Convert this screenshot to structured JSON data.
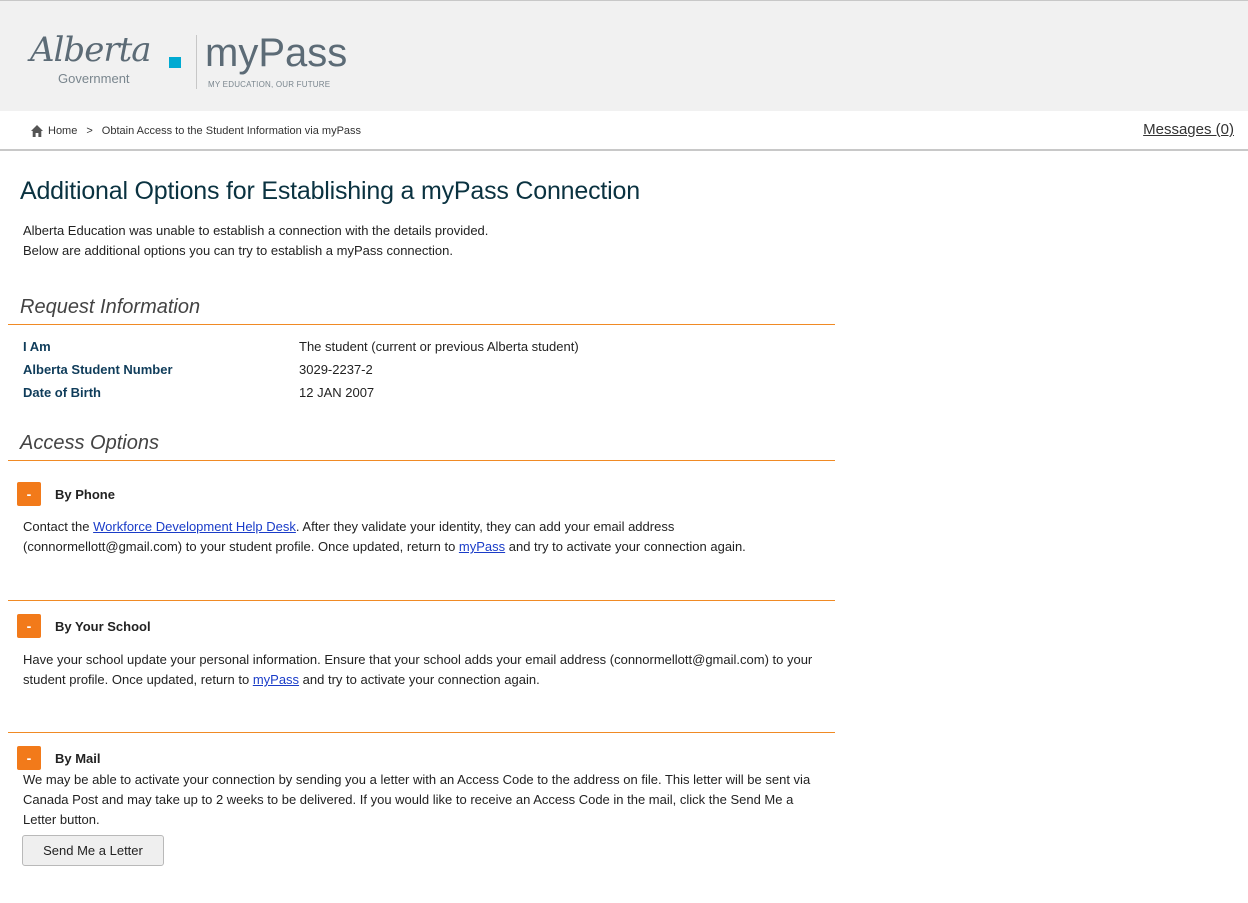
{
  "header": {
    "alberta_logo": "Alberta",
    "government_text": "Government",
    "mypass_title": "myPass",
    "mypass_tagline": "MY EDUCATION, OUR FUTURE"
  },
  "breadcrumb": {
    "home": "Home",
    "separator": ">",
    "current": "Obtain Access to the Student Information via myPass"
  },
  "messages_link": "Messages (0)",
  "page": {
    "title": "Additional Options for Establishing a myPass Connection",
    "intro_line1": "Alberta Education was unable to establish a connection with the details provided.",
    "intro_line2": "Below are additional options you can try to establish a myPass connection."
  },
  "request_info": {
    "heading": "Request Information",
    "rows": [
      {
        "label": "I Am",
        "value": "The student (current or previous Alberta student)"
      },
      {
        "label": "Alberta Student Number",
        "value": "3029-2237-2"
      },
      {
        "label": "Date of Birth",
        "value": "12 JAN 2007"
      }
    ]
  },
  "access_options": {
    "heading": "Access Options",
    "toggle_symbol": "-",
    "phone": {
      "title": "By Phone",
      "text_before": "Contact the ",
      "helpdesk_link": "Workforce Development Help Desk",
      "text_middle": ". After they validate your identity, they can add your email address (connormellott@gmail.com) to your student profile. Once updated, return to ",
      "mypass_link": "myPass",
      "text_after": " and try to activate your connection again."
    },
    "school": {
      "title": "By Your School",
      "text_before": "Have your school update your personal information. Ensure that your school adds your email address (connormellott@gmail.com) to your student profile. Once updated, return to ",
      "mypass_link": "myPass",
      "text_after": " and try to activate your connection again."
    },
    "mail": {
      "title": "By Mail",
      "text": "We may be able to activate your connection by sending you a letter with an Access Code to the address on file. This letter will be sent via Canada Post and may take up to 2 weeks to be delivered. If you would like to receive an Access Code in the mail, click the Send Me a Letter button.",
      "button_label": "Send Me a Letter"
    }
  },
  "colors": {
    "accent_orange": "#f27a1a",
    "rule_orange": "#f08a24",
    "heading_blue": "#0a3240",
    "label_blue": "#0f3c5a",
    "link_blue": "#1a3cc8",
    "logo_cyan": "#00aad2"
  }
}
